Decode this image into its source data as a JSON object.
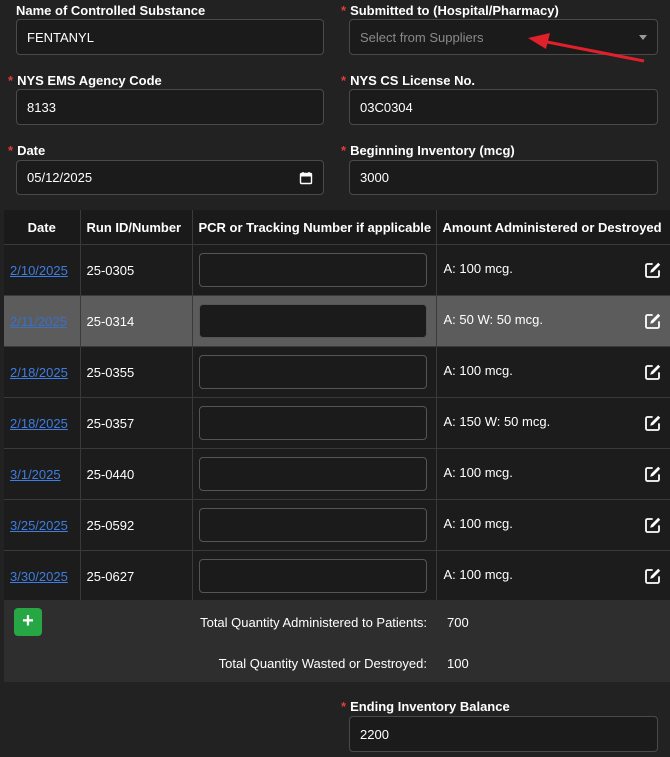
{
  "form": {
    "substance_label": "Name of Controlled Substance",
    "substance_value": "FENTANYL",
    "submitted_label": "Submitted to (Hospital/Pharmacy)",
    "submitted_placeholder": "Select from Suppliers",
    "agency_label": "NYS EMS Agency Code",
    "agency_value": "8133",
    "license_label": "NYS CS License No.",
    "license_value": "03C0304",
    "date_label": "Date",
    "date_value": "05/12/2025",
    "beginning_label": "Beginning Inventory (mcg)",
    "beginning_value": "3000",
    "required_mark": "*"
  },
  "table": {
    "headers": [
      "Date",
      "Run ID/Number",
      "PCR or Tracking Number if applicable",
      "Amount Administered or Destroyed"
    ],
    "rows": [
      {
        "date": "2/10/2025",
        "run": "25-0305",
        "amount": "A: 100 mcg."
      },
      {
        "date": "2/11/2025",
        "run": "25-0314",
        "amount": "A: 50 W: 50 mcg."
      },
      {
        "date": "2/18/2025",
        "run": "25-0355",
        "amount": "A: 100 mcg."
      },
      {
        "date": "2/18/2025",
        "run": "25-0357",
        "amount": "A: 150 W: 50 mcg."
      },
      {
        "date": "3/1/2025",
        "run": "25-0440",
        "amount": "A: 100 mcg."
      },
      {
        "date": "3/25/2025",
        "run": "25-0592",
        "amount": "A: 100 mcg."
      },
      {
        "date": "3/30/2025",
        "run": "25-0627",
        "amount": "A: 100 mcg."
      }
    ],
    "selected_row": 1
  },
  "totals": {
    "add_label": "+",
    "administered_label": "Total Quantity Administered to Patients:",
    "administered_value": "700",
    "wasted_label": "Total Quantity Wasted or Destroyed:",
    "wasted_value": "100"
  },
  "ending": {
    "label": "Ending Inventory Balance",
    "value": "2200"
  },
  "icons": {
    "edit": "edit-icon",
    "calendar": "calendar-icon",
    "dropdown": "chevron-down-icon",
    "annotation": "red-arrow"
  },
  "colors": {
    "background": "#222222",
    "required": "#e03c3c",
    "link": "#3f7de0",
    "add_button": "#27a744",
    "arrow": "#e0202a"
  }
}
